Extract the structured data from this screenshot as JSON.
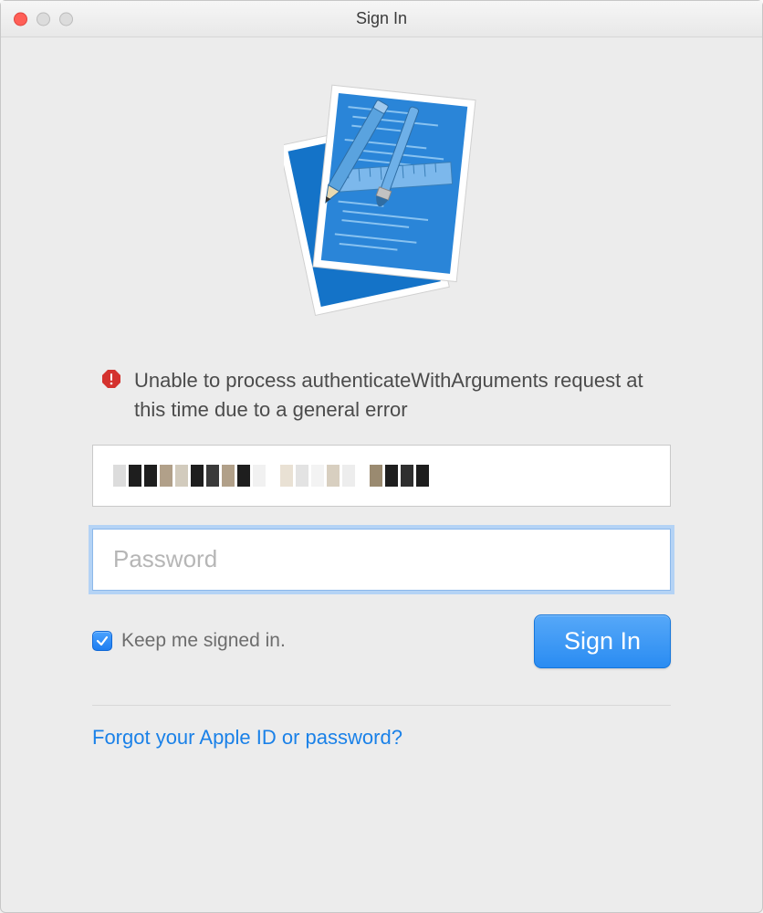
{
  "window": {
    "title": "Sign In"
  },
  "error": {
    "message": "Unable to process authenticateWithArguments request at this time due to a general error"
  },
  "form": {
    "apple_id_value": "",
    "password_value": "",
    "password_placeholder": "Password",
    "keep_signed_in_label": "Keep me signed in.",
    "keep_signed_in_checked": true,
    "submit_label": "Sign In"
  },
  "links": {
    "forgot": "Forgot your Apple ID or password?"
  },
  "colors": {
    "accent": "#2a8cf2",
    "link": "#1a81e8",
    "error": "#d4322e"
  }
}
